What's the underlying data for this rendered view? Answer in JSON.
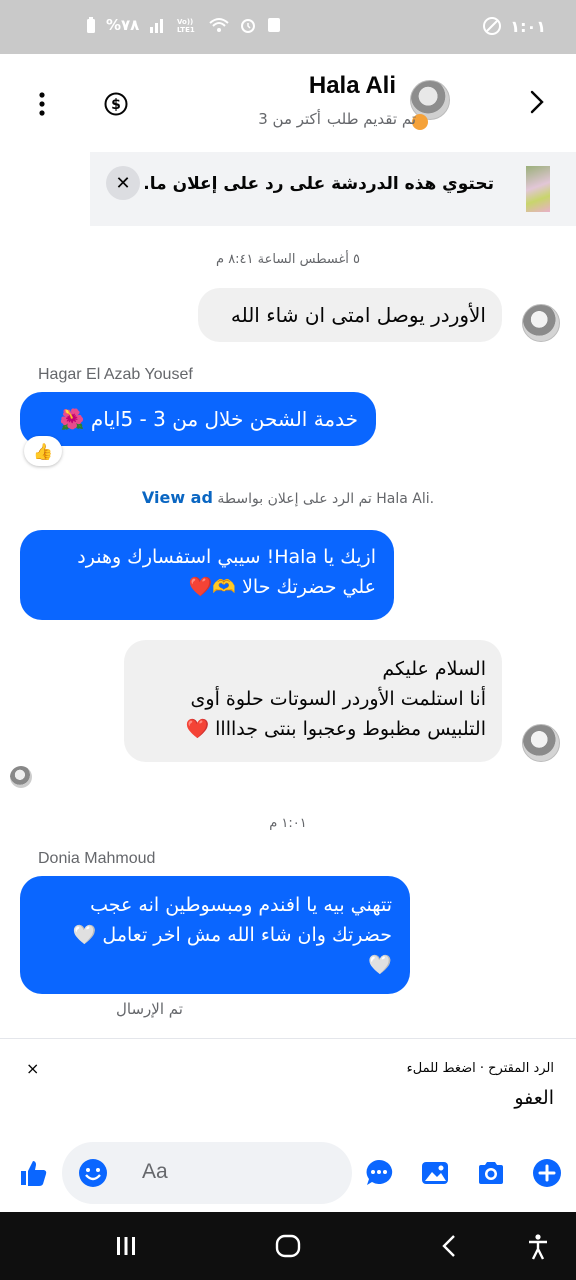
{
  "status_bar": {
    "time": "١:٠١",
    "battery": "%٧٨"
  },
  "header": {
    "name": "Hala Ali",
    "status": "تم تقديم طلب",
    "status_extra": "أكتر من 3",
    "status_dot_color": "#f5a23a"
  },
  "banner": {
    "text": "تحتوي هذه الدردشة على رد على إعلان ما."
  },
  "conversation": {
    "timestamp_1": "٥ أغسطس الساعة ٨:٤١ م",
    "msg_1": "الأوردر يوصل امتى ان شاء الله",
    "sender_1": "Hagar El Azab Yousef",
    "msg_2": "خدمة الشحن خلال من 3 - 5ايام 🌺",
    "reaction_2": "👍",
    "ad_reply_prefix": "تم الرد على إعلان بواسطة Hala Ali.",
    "ad_reply_link": "View ad",
    "msg_3_line1": "ازيك يا Hala!  سيبي استفسارك وهنرد",
    "msg_3_line2": "علي حضرتك حالا 🫶❤️",
    "msg_4_line1": "السلام عليكم",
    "msg_4_line2": "أنا استلمت الأوردر  السوتات حلوة أوى",
    "msg_4_line3": "التلبيس مظبوط وعجبوا بنتى جداااا ❤️",
    "timestamp_2": "١:٠١ م",
    "sender_2": "Donia Mahmoud",
    "msg_5_line1": "تتهني بيه يا افندم ومبسوطين انه عجب",
    "msg_5_line2": "حضرتك وان شاء الله مش اخر تعامل 🤍",
    "msg_5_line3": "🤍",
    "sent_label": "تم الإرسال"
  },
  "suggested": {
    "title": "الرد المقترح · اضغط للملء",
    "reply": "العفو",
    "close": "×"
  },
  "composer": {
    "placeholder": "Aa"
  },
  "colors": {
    "accent": "#0a66ff",
    "incoming_bubble": "#f0f0f0"
  }
}
